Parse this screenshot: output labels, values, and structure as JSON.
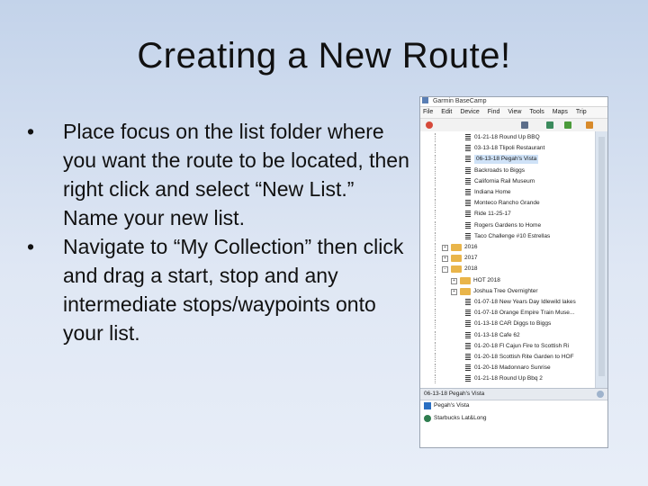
{
  "slide": {
    "title": "Creating a New Route!",
    "bullets": [
      {
        "marker": "•",
        "text": "Place focus on the list folder where you want the route to be located, then right click and select “New List.” Name your new list."
      },
      {
        "marker": "•",
        "text": "Navigate to “My Collection” then click and drag a start, stop and any intermediate stops/waypoints onto your list."
      }
    ]
  },
  "screenshot": {
    "window_title": "Garmin BaseCamp",
    "menu": [
      "File",
      "Edit",
      "Device",
      "Find",
      "View",
      "Tools",
      "Maps",
      "Trip"
    ],
    "toolbar_icons": [
      "no-icon",
      "lock-icon",
      "map-icon",
      "tree-icon",
      "pencil-icon"
    ],
    "tree_items": [
      {
        "kind": "route",
        "label": "01-21-18 Round Up BBQ"
      },
      {
        "kind": "route",
        "label": "03-13-18 Tlipoli Restaurant"
      },
      {
        "kind": "route",
        "label": "06-13-18 Pegah's Vista",
        "selected": true
      },
      {
        "kind": "route",
        "label": "Backroads to Biggs"
      },
      {
        "kind": "route",
        "label": "California Rail Museum"
      },
      {
        "kind": "route",
        "label": "Indiana Home"
      },
      {
        "kind": "route",
        "label": "Monteco Rancho Grande"
      },
      {
        "kind": "route",
        "label": "Ride 11-25-17"
      },
      {
        "kind": "route",
        "label": "Rogers Gardens to Home"
      },
      {
        "kind": "route",
        "label": "Taco Challenge #10 Estrellas"
      },
      {
        "kind": "folder",
        "label": "2016",
        "toggle": "+"
      },
      {
        "kind": "folder",
        "label": "2017",
        "toggle": "+"
      },
      {
        "kind": "folder",
        "label": "2018",
        "toggle": "−"
      },
      {
        "kind": "folder",
        "label": "HOT 2018",
        "toggle": "+"
      },
      {
        "kind": "folder",
        "label": "Joshua Tree Overnighter",
        "toggle": "+"
      },
      {
        "kind": "route",
        "label": "01-07-18 New Years Day Idlewild lakes"
      },
      {
        "kind": "route",
        "label": "01-07-18 Orange Empire Train Muse..."
      },
      {
        "kind": "route",
        "label": "01-13-18 CAR Diggs to Biggs"
      },
      {
        "kind": "route",
        "label": "01-13-18 Cafe 62"
      },
      {
        "kind": "route",
        "label": "01-20-18 Fl Cajun Fire to Scottish Ri"
      },
      {
        "kind": "route",
        "label": "01-20-18 Scottish Rite Garden to HOF"
      },
      {
        "kind": "route",
        "label": "01-20-18 Madonnaro Sunrise"
      },
      {
        "kind": "route",
        "label": "01-21-18 Round Up Bbq 2"
      }
    ],
    "bottom_panel": {
      "header": "06-13-18 Pegah's Vista",
      "items": [
        {
          "icon": "flag-icon",
          "label": "Pegah's Vista"
        },
        {
          "icon": "coffee-icon",
          "label": "Starbucks Lat&Long"
        }
      ]
    }
  }
}
